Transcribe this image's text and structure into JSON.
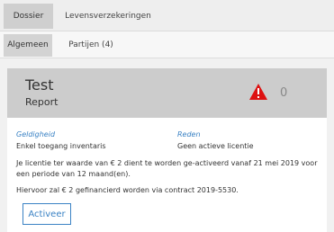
{
  "tabs_primary": [
    {
      "label": "Dossier",
      "active": true
    },
    {
      "label": "Levensverzekeringen",
      "active": false
    }
  ],
  "tabs_secondary": [
    {
      "label": "Algemeen",
      "active": true
    },
    {
      "label": "Partijen (4)",
      "active": false
    }
  ],
  "card": {
    "title": "Test",
    "subtitle": "Report",
    "warning_icon": "warning-triangle-icon",
    "warning_count": "0",
    "fields": [
      {
        "label": "Geldigheid",
        "value": "Enkel toegang inventaris"
      },
      {
        "label": "Reden",
        "value": "Geen actieve licentie"
      }
    ],
    "message_1": "Je licentie ter waarde van € 2 dient te worden ge-activeerd vanaf 21 mei 2019 voor een periode van 12 maand(en).",
    "message_2": "Hiervoor zal € 2 gefinancierd worden via contract 2019-5530.",
    "activate_label": "Activeer"
  },
  "colors": {
    "accent": "#3a82c4",
    "warning": "#dd1111",
    "header_bg": "#cccccc"
  }
}
